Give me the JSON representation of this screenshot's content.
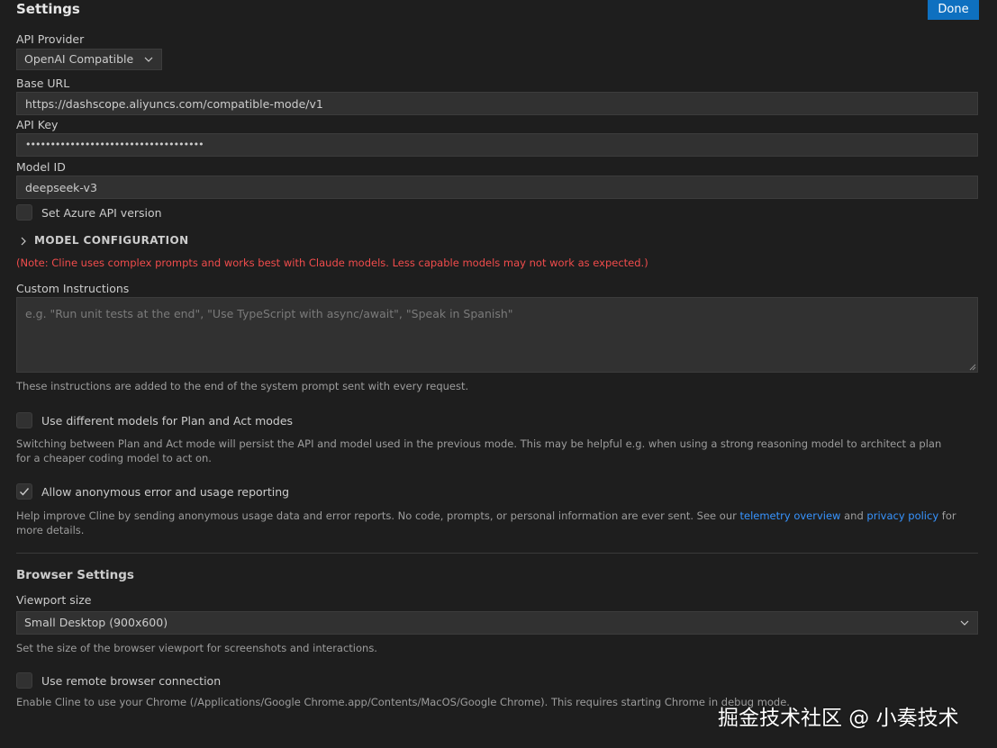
{
  "header": {
    "title": "Settings",
    "done_label": "Done"
  },
  "api_provider": {
    "label": "API Provider",
    "selected": "OpenAI Compatible"
  },
  "base_url": {
    "label": "Base URL",
    "value": "https://dashscope.aliyuncs.com/compatible-mode/v1"
  },
  "api_key": {
    "label": "API Key",
    "value": "••••••••••••••••••••••••••••••••••••"
  },
  "model_id": {
    "label": "Model ID",
    "value": "deepseek-v3"
  },
  "azure_version": {
    "label": "Set Azure API version",
    "checked": false
  },
  "model_config": {
    "label": "MODEL CONFIGURATION"
  },
  "note": "(Note: Cline uses complex prompts and works best with Claude models. Less capable models may not work as expected.)",
  "custom_instructions": {
    "label": "Custom Instructions",
    "placeholder": "e.g. \"Run unit tests at the end\", \"Use TypeScript with async/await\", \"Speak in Spanish\"",
    "description": "These instructions are added to the end of the system prompt sent with every request."
  },
  "plan_act": {
    "label": "Use different models for Plan and Act modes",
    "checked": false,
    "description": "Switching between Plan and Act mode will persist the API and model used in the previous mode. This may be helpful e.g. when using a strong reasoning model to architect a plan for a cheaper coding model to act on."
  },
  "telemetry": {
    "label": "Allow anonymous error and usage reporting",
    "checked": true,
    "desc_before": "Help improve Cline by sending anonymous usage data and error reports. No code, prompts, or personal information are ever sent. See our ",
    "link1": "telemetry overview",
    "desc_mid": " and ",
    "link2": "privacy policy",
    "desc_after": " for more details."
  },
  "browser": {
    "title": "Browser Settings",
    "viewport_label": "Viewport size",
    "viewport_selected": "Small Desktop (900x600)",
    "viewport_description": "Set the size of the browser viewport for screenshots and interactions.",
    "remote_label": "Use remote browser connection",
    "remote_checked": false,
    "remote_description": "Enable Cline to use your Chrome (/Applications/Google Chrome.app/Contents/MacOS/Google Chrome). This requires starting Chrome in debug mode."
  },
  "watermark": "掘金技术社区 @ 小奏技术",
  "icons": {
    "dropdown": "chevron-down-icon",
    "collapse": "chevron-right-icon",
    "check": "check-icon"
  },
  "colors": {
    "accent": "#0e70c0",
    "link": "#3794ff",
    "warning": "#f14c4c",
    "background": "#1e1e1e"
  }
}
